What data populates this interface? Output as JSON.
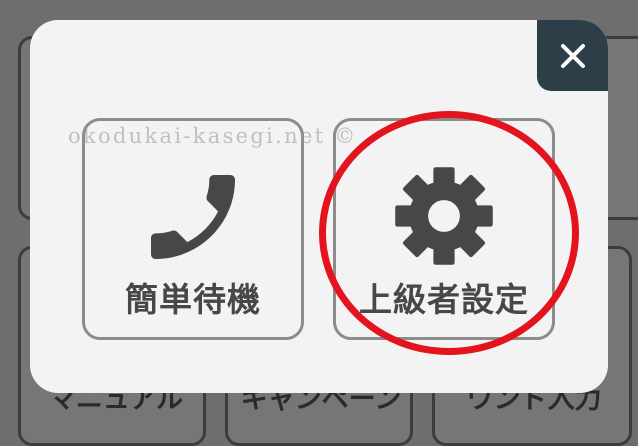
{
  "background": {
    "tiles": [
      {
        "label": ""
      },
      {
        "label": ""
      },
      {
        "label": "マニュアル"
      },
      {
        "label": "キャンペーン"
      },
      {
        "label": "ワンド入力"
      }
    ]
  },
  "modal": {
    "close_icon": "close-icon",
    "watermark": "okodukai-kasegi.net ©",
    "options": [
      {
        "label": "簡単待機",
        "icon": "phone-icon"
      },
      {
        "label": "上級者設定",
        "icon": "gear-icon"
      }
    ]
  },
  "colors": {
    "overlay_bg": "#6e6e6e",
    "modal_bg": "#f3f3f3",
    "close_bg": "#2d3e48",
    "icon": "#474747",
    "highlight": "#e3141e"
  }
}
